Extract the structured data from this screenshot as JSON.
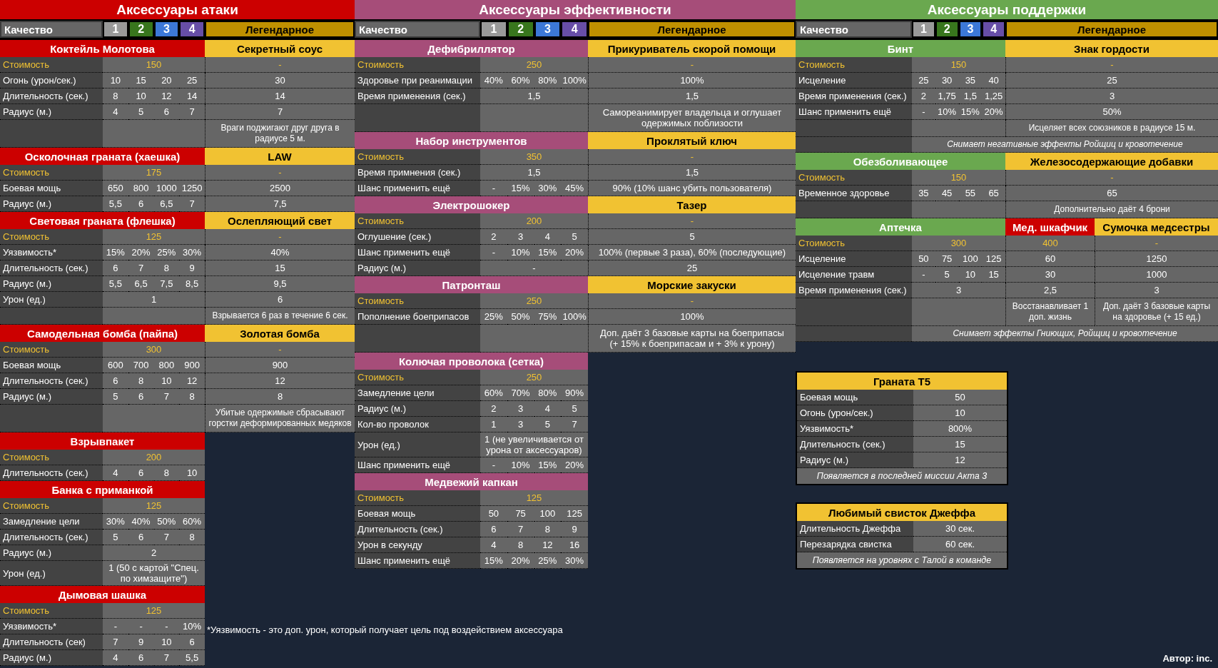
{
  "sections": [
    {
      "title": "Аксессуары атаки",
      "kind": "attack",
      "color": "#cc0000",
      "quality": {
        "label": "Качество",
        "tiers": [
          {
            "label": "1",
            "color": "#999999"
          },
          {
            "label": "2",
            "color": "#38761d"
          },
          {
            "label": "3",
            "color": "#3c78d8"
          },
          {
            "label": "4",
            "color": "#674ea7"
          }
        ],
        "legendary": "Легендарное"
      },
      "items": [
        {
          "name": "Коктейль Молотова",
          "legendary": [
            {
              "name": "Секретный соус",
              "color": "#f1c232"
            }
          ],
          "rows": [
            {
              "kind": "cost",
              "label": "Стоимость",
              "values": [
                "150"
              ],
              "legendary": [
                "-"
              ]
            },
            {
              "kind": "stat",
              "label": "Огонь (урон/сек.)",
              "values": [
                "10",
                "15",
                "20",
                "25"
              ],
              "legendary": [
                "30"
              ]
            },
            {
              "kind": "stat",
              "label": "Длительность (сек.)",
              "values": [
                "8",
                "10",
                "12",
                "14"
              ],
              "legendary": [
                "14"
              ]
            },
            {
              "kind": "stat",
              "label": "Радиус (м.)",
              "values": [
                "4",
                "5",
                "6",
                "7"
              ],
              "legendary": [
                "7"
              ]
            },
            {
              "kind": "note",
              "legendary": [
                "Враги поджигают друг друга в радиусе 5 м."
              ]
            }
          ]
        },
        {
          "name": "Осколочная граната (хаешка)",
          "legendary": [
            {
              "name": "LAW",
              "color": "#f1c232"
            }
          ],
          "rows": [
            {
              "kind": "cost",
              "label": "Стоимость",
              "values": [
                "175"
              ],
              "legendary": [
                "-"
              ]
            },
            {
              "kind": "stat",
              "label": "Боевая мощь",
              "values": [
                "650",
                "800",
                "1000",
                "1250"
              ],
              "legendary": [
                "2500"
              ]
            },
            {
              "kind": "stat",
              "label": "Радиус (м.)",
              "values": [
                "5,5",
                "6",
                "6,5",
                "7"
              ],
              "legendary": [
                "7,5"
              ]
            }
          ]
        },
        {
          "name": "Световая граната (флешка)",
          "legendary": [
            {
              "name": "Ослепляющий свет",
              "color": "#f1c232"
            }
          ],
          "rows": [
            {
              "kind": "cost",
              "label": "Стоимость",
              "values": [
                "125"
              ],
              "legendary": [
                "-"
              ]
            },
            {
              "kind": "stat",
              "label": "Уязвимость*",
              "values": [
                "15%",
                "20%",
                "25%",
                "30%"
              ],
              "legendary": [
                "40%"
              ]
            },
            {
              "kind": "stat",
              "label": "Длительность (сек.)",
              "values": [
                "6",
                "7",
                "8",
                "9"
              ],
              "legendary": [
                "15"
              ]
            },
            {
              "kind": "stat",
              "label": "Радиус (м.)",
              "values": [
                "5,5",
                "6,5",
                "7,5",
                "8,5"
              ],
              "legendary": [
                "9,5"
              ]
            },
            {
              "kind": "stat",
              "label": "Урон (ед.)",
              "values": [
                "1"
              ],
              "legendary": [
                "6"
              ]
            },
            {
              "kind": "note",
              "legendary": [
                "Взрывается 6 раз в течение 6 сек."
              ]
            }
          ]
        },
        {
          "name": "Самодельная бомба (пайпа)",
          "legendary": [
            {
              "name": "Золотая бомба",
              "color": "#f1c232"
            }
          ],
          "rows": [
            {
              "kind": "cost",
              "label": "Стоимость",
              "values": [
                "300"
              ],
              "legendary": [
                "-"
              ]
            },
            {
              "kind": "stat",
              "label": "Боевая мощь",
              "values": [
                "600",
                "700",
                "800",
                "900"
              ],
              "legendary": [
                "900"
              ]
            },
            {
              "kind": "stat",
              "label": "Длительность (сек.)",
              "values": [
                "6",
                "8",
                "10",
                "12"
              ],
              "legendary": [
                "12"
              ]
            },
            {
              "kind": "stat",
              "label": "Радиус (м.)",
              "values": [
                "5",
                "6",
                "7",
                "8"
              ],
              "legendary": [
                "8"
              ]
            },
            {
              "kind": "note",
              "legendary": [
                "Убитые одержимые сбрасывают горстки деформированных медяков"
              ]
            }
          ]
        },
        {
          "name": "Взрывпакет",
          "rows": [
            {
              "kind": "cost",
              "label": "Стоимость",
              "values": [
                "200"
              ]
            },
            {
              "kind": "stat",
              "label": "Длительность (сек.)",
              "values": [
                "4",
                "6",
                "8",
                "10"
              ]
            }
          ]
        },
        {
          "name": "Банка с приманкой",
          "rows": [
            {
              "kind": "cost",
              "label": "Стоимость",
              "values": [
                "125"
              ]
            },
            {
              "kind": "stat",
              "label": "Замедление цели",
              "values": [
                "30%",
                "40%",
                "50%",
                "60%"
              ]
            },
            {
              "kind": "stat",
              "label": "Длительность (сек.)",
              "values": [
                "5",
                "6",
                "7",
                "8"
              ]
            },
            {
              "kind": "stat",
              "label": "Радиус (м.)",
              "values": [
                "2"
              ]
            },
            {
              "kind": "stat",
              "label": "Урон (ед.)",
              "values": [
                "1 (50 с картой \"Спец. по химзащите\")"
              ]
            }
          ]
        },
        {
          "name": "Дымовая шашка",
          "rows": [
            {
              "kind": "cost",
              "label": "Стоимость",
              "values": [
                "125"
              ]
            },
            {
              "kind": "stat",
              "label": "Уязвимость*",
              "values": [
                "-",
                "-",
                "-",
                "10%"
              ]
            },
            {
              "kind": "stat",
              "label": "Длительность (сек)",
              "values": [
                "7",
                "9",
                "10",
                "6"
              ]
            },
            {
              "kind": "stat",
              "label": "Радиус (м.)",
              "values": [
                "4",
                "6",
                "7",
                "5,5"
              ]
            }
          ]
        }
      ]
    },
    {
      "title": "Аксессуары эффективности",
      "kind": "efficiency",
      "color": "#a64d79",
      "quality": {
        "label": "Качество",
        "tiers": [
          {
            "label": "1",
            "color": "#999999"
          },
          {
            "label": "2",
            "color": "#38761d"
          },
          {
            "label": "3",
            "color": "#3c78d8"
          },
          {
            "label": "4",
            "color": "#674ea7"
          }
        ],
        "legendary": "Легендарное"
      },
      "items": [
        {
          "name": "Дефибриллятор",
          "legendary": [
            {
              "name": "Прикуриватель скорой помощи",
              "color": "#f1c232"
            }
          ],
          "rows": [
            {
              "kind": "cost",
              "label": "Стоимость",
              "values": [
                "250"
              ],
              "legendary": [
                "-"
              ]
            },
            {
              "kind": "stat",
              "label": "Здоровье при реанимации",
              "values": [
                "40%",
                "60%",
                "80%",
                "100%"
              ],
              "legendary": [
                "100%"
              ]
            },
            {
              "kind": "stat",
              "label": "Время применения (сек.)",
              "values": [
                "1,5"
              ],
              "legendary": [
                "1,5"
              ]
            },
            {
              "kind": "note",
              "legendary": [
                "Самореанимирует владельца и оглушает одержимых поблизости"
              ]
            }
          ]
        },
        {
          "name": "Набор инструментов",
          "legendary": [
            {
              "name": "Проклятый ключ",
              "color": "#f1c232"
            }
          ],
          "rows": [
            {
              "kind": "cost",
              "label": "Стоимость",
              "values": [
                "350"
              ],
              "legendary": [
                "-"
              ]
            },
            {
              "kind": "stat",
              "label": "Время примнения (сек.)",
              "values": [
                "1,5"
              ],
              "legendary": [
                "1,5"
              ]
            },
            {
              "kind": "stat",
              "label": "Шанс применить ещё",
              "values": [
                "-",
                "15%",
                "30%",
                "45%"
              ],
              "legendary": [
                "90% (10% шанс убить пользователя)"
              ]
            }
          ]
        },
        {
          "name": "Электрошокер",
          "legendary": [
            {
              "name": "Тазер",
              "color": "#f1c232"
            }
          ],
          "rows": [
            {
              "kind": "cost",
              "label": "Стоимость",
              "values": [
                "200"
              ],
              "legendary": [
                "-"
              ]
            },
            {
              "kind": "stat",
              "label": "Оглушение (сек.)",
              "values": [
                "2",
                "3",
                "4",
                "5"
              ],
              "legendary": [
                "5"
              ]
            },
            {
              "kind": "stat",
              "label": "Шанс применить ещё",
              "values": [
                "-",
                "10%",
                "15%",
                "20%"
              ],
              "legendary": [
                "100% (первые 3 раза), 60% (последующие)"
              ]
            },
            {
              "kind": "stat",
              "label": "Радиус (м.)",
              "values": [
                "-"
              ],
              "legendary": [
                "25"
              ]
            }
          ]
        },
        {
          "name": "Патронташ",
          "legendary": [
            {
              "name": "Морские закуски",
              "color": "#f1c232"
            }
          ],
          "rows": [
            {
              "kind": "cost",
              "label": "Стоимость",
              "values": [
                "250"
              ],
              "legendary": [
                "-"
              ]
            },
            {
              "kind": "stat",
              "label": "Пополнение боеприпасов",
              "values": [
                "25%",
                "50%",
                "75%",
                "100%"
              ],
              "legendary": [
                "100%"
              ]
            },
            {
              "kind": "note",
              "legendary": [
                "Доп. даёт 3 базовые карты на боеприпасы (+ 15% к боеприпасам и + 3% к урону)"
              ]
            }
          ]
        },
        {
          "name": "Колючая проволока (сетка)",
          "rows": [
            {
              "kind": "cost",
              "label": "Стоимость",
              "values": [
                "250"
              ]
            },
            {
              "kind": "stat",
              "label": "Замедление цели",
              "values": [
                "60%",
                "70%",
                "80%",
                "90%"
              ]
            },
            {
              "kind": "stat",
              "label": "Радиус (м.)",
              "values": [
                "2",
                "3",
                "4",
                "5"
              ]
            },
            {
              "kind": "stat",
              "label": "Кол-во проволок",
              "values": [
                "1",
                "3",
                "5",
                "7"
              ]
            },
            {
              "kind": "stat",
              "label": "Урон (ед.)",
              "values": [
                "1 (не увеличивается от урона от аксессуаров)"
              ]
            },
            {
              "kind": "stat",
              "label": "Шанс применить ещё",
              "values": [
                "-",
                "10%",
                "15%",
                "20%"
              ]
            }
          ]
        },
        {
          "name": "Медвежий капкан",
          "rows": [
            {
              "kind": "cost",
              "label": "Стоимость",
              "values": [
                "125"
              ]
            },
            {
              "kind": "stat",
              "label": "Боевая мощь",
              "values": [
                "50",
                "75",
                "100",
                "125"
              ]
            },
            {
              "kind": "stat",
              "label": "Длительность (сек.)",
              "values": [
                "6",
                "7",
                "8",
                "9"
              ]
            },
            {
              "kind": "stat",
              "label": "Урон в секунду",
              "values": [
                "4",
                "8",
                "12",
                "16"
              ]
            },
            {
              "kind": "stat",
              "label": "Шанс применить ещё",
              "values": [
                "15%",
                "20%",
                "25%",
                "30%"
              ]
            }
          ]
        }
      ]
    },
    {
      "title": "Аксессуары поддержки",
      "kind": "support",
      "color": "#6aa84f",
      "quality": {
        "label": "Качество",
        "tiers": [
          {
            "label": "1",
            "color": "#999999"
          },
          {
            "label": "2",
            "color": "#38761d"
          },
          {
            "label": "3",
            "color": "#3c78d8"
          },
          {
            "label": "4",
            "color": "#674ea7"
          }
        ],
        "legendary": "Легендарное"
      },
      "items": [
        {
          "name": "Бинт",
          "legendary": [
            {
              "name": "Знак гордости",
              "color": "#f1c232"
            }
          ],
          "rows": [
            {
              "kind": "cost",
              "label": "Стоимость",
              "values": [
                "150"
              ],
              "legendary": [
                "-"
              ]
            },
            {
              "kind": "stat",
              "label": "Исцеление",
              "values": [
                "25",
                "30",
                "35",
                "40"
              ],
              "legendary": [
                "25"
              ]
            },
            {
              "kind": "stat",
              "label": "Время применения (сек.)",
              "values": [
                "2",
                "1,75",
                "1,5",
                "1,25"
              ],
              "legendary": [
                "3"
              ]
            },
            {
              "kind": "stat",
              "label": "Шанс применить ещё",
              "values": [
                "-",
                "10%",
                "15%",
                "20%"
              ],
              "legendary": [
                "50%"
              ]
            },
            {
              "kind": "note",
              "legendary": [
                "Исцеляет всех союзников в радиусе 15 м."
              ]
            },
            {
              "kind": "remark",
              "text": "Снимает негативные эффекты Ройщиц и кровотечение"
            }
          ]
        },
        {
          "name": "Обезболивающее",
          "legendary": [
            {
              "name": "Железосодержающие добавки",
              "color": "#f1c232"
            }
          ],
          "rows": [
            {
              "kind": "cost",
              "label": "Стоимость",
              "values": [
                "150"
              ],
              "legendary": [
                "-"
              ]
            },
            {
              "kind": "stat",
              "label": "Временное здоровье",
              "values": [
                "35",
                "45",
                "55",
                "65"
              ],
              "legendary": [
                "65"
              ]
            },
            {
              "kind": "note",
              "legendary": [
                "Дополнительно даёт 4 брони"
              ]
            }
          ]
        },
        {
          "name": "Аптечка",
          "legendary": [
            {
              "name": "Мед. шкафчик",
              "color": "#cc0000"
            },
            {
              "name": "Сумочка медсестры",
              "color": "#f1c232"
            }
          ],
          "rows": [
            {
              "kind": "cost",
              "label": "Стоимость",
              "values": [
                "300"
              ],
              "legendary": [
                "400",
                "-"
              ]
            },
            {
              "kind": "stat",
              "label": "Исцеление",
              "values": [
                "50",
                "75",
                "100",
                "125"
              ],
              "legendary": [
                "60",
                "1250"
              ]
            },
            {
              "kind": "stat",
              "label": "Исцеление травм",
              "values": [
                "-",
                "5",
                "10",
                "15"
              ],
              "legendary": [
                "30",
                "1000"
              ]
            },
            {
              "kind": "stat",
              "label": "Время применения (сек.)",
              "values": [
                "3"
              ],
              "legendary": [
                "2,5",
                "3"
              ]
            },
            {
              "kind": "note",
              "legendary": [
                "Восстанавливает 1 доп. жизнь",
                "Доп. даёт 3 базовые карты на здоровье (+ 15 ед.)"
              ]
            },
            {
              "kind": "remark",
              "text": "Снимает эффекты Гниющих, Ройщиц и кровотечение"
            }
          ]
        }
      ],
      "cards": [
        {
          "title": "Граната Т5",
          "rows": [
            {
              "label": "Боевая мощь",
              "value": "50"
            },
            {
              "label": "Огонь (урон/сек.)",
              "value": "10"
            },
            {
              "label": "Уязвимость*",
              "value": "800%"
            },
            {
              "label": "Длительность (сек.)",
              "value": "15"
            },
            {
              "label": "Радиус (м.)",
              "value": "12"
            }
          ],
          "note": "Появляется в последней миссии Акта 3"
        },
        {
          "title": "Любимый свисток Джеффа",
          "rows": [
            {
              "label": "Длительность Джеффа",
              "value": "30 сек."
            },
            {
              "label": "Перезарядка свистка",
              "value": "60 сек."
            }
          ],
          "note": "Появляется на уровнях с Талой в команде"
        }
      ]
    }
  ],
  "footnote": "*Уязвимость - это доп. урон, который получает цель под воздействием аксессуара",
  "author": "Автор: inc."
}
